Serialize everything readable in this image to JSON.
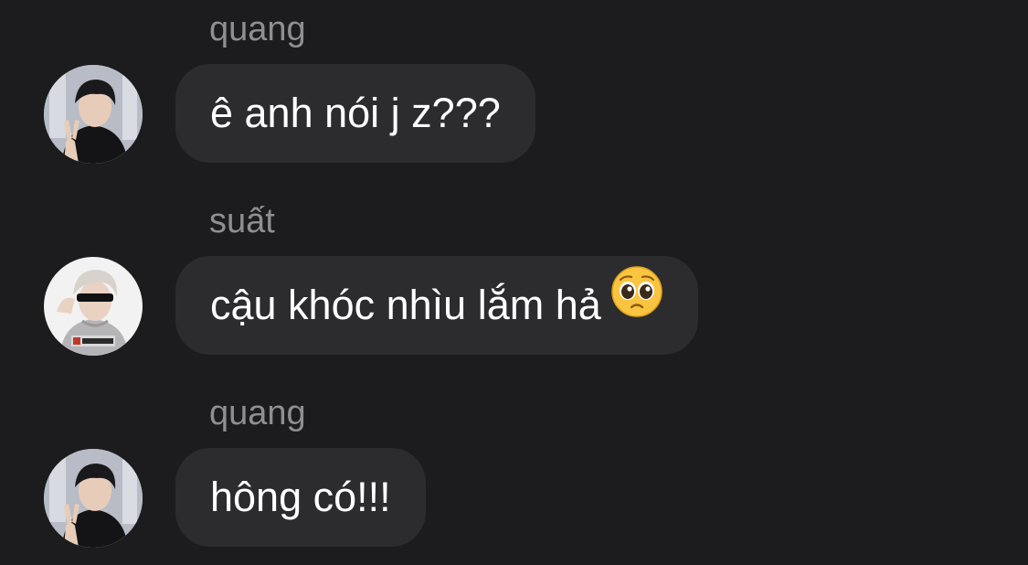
{
  "messages": [
    {
      "sender": "quang",
      "text": "ê anh nói j z???",
      "avatar": "avatar-quang",
      "emoji": ""
    },
    {
      "sender": "suất",
      "text": "cậu khóc nhìu lắm hả",
      "avatar": "avatar-suat",
      "emoji": "pleading-face-icon"
    },
    {
      "sender": "quang",
      "text": "hông có!!!",
      "avatar": "avatar-quang",
      "emoji": ""
    }
  ],
  "colors": {
    "background": "#1c1c1e",
    "bubble": "#2c2c2e",
    "sender_text": "#8e8e93",
    "message_text": "#ffffff"
  }
}
